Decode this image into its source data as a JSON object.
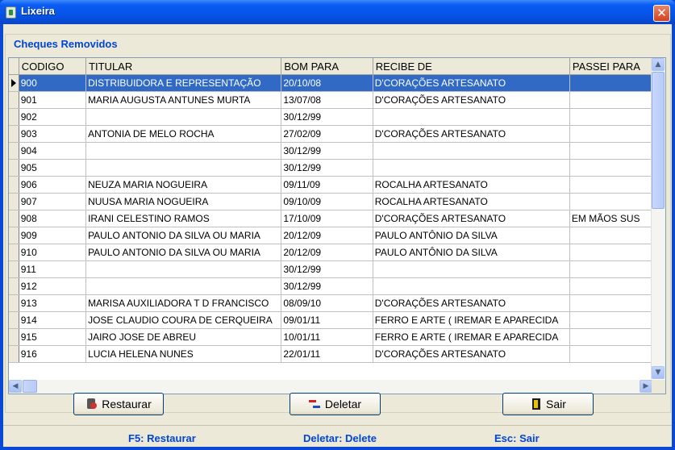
{
  "window": {
    "title": "Lixeira"
  },
  "group": {
    "title": "Cheques Removidos"
  },
  "grid": {
    "columns": [
      "CODIGO",
      "TITULAR",
      "BOM PARA",
      "RECIBE DE",
      "PASSEI PARA"
    ],
    "rows": [
      [
        "900",
        "DISTRIBUIDORA E REPRESENTAÇÃO",
        "20/10/08",
        "D'CORAÇÕES ARTESANATO",
        ""
      ],
      [
        "901",
        "MARIA AUGUSTA ANTUNES MURTA",
        "13/07/08",
        "D'CORAÇÕES ARTESANATO",
        ""
      ],
      [
        "902",
        "",
        "30/12/99",
        "",
        ""
      ],
      [
        "903",
        "ANTONIA DE MELO ROCHA",
        "27/02/09",
        "D'CORAÇÕES ARTESANATO",
        ""
      ],
      [
        "904",
        "",
        "30/12/99",
        "",
        ""
      ],
      [
        "905",
        "",
        "30/12/99",
        "",
        ""
      ],
      [
        "906",
        "NEUZA MARIA NOGUEIRA",
        "09/11/09",
        "ROCALHA ARTESANATO",
        ""
      ],
      [
        "907",
        "NUUSA MARIA NOGUEIRA",
        "09/10/09",
        "ROCALHA ARTESANATO",
        ""
      ],
      [
        "908",
        "IRANI CELESTINO RAMOS",
        "17/10/09",
        "D'CORAÇÕES ARTESANATO",
        "EM MÃOS SUS"
      ],
      [
        "909",
        "PAULO ANTONIO DA SILVA OU MARIA",
        "20/12/09",
        "PAULO ANTÔNIO DA SILVA",
        ""
      ],
      [
        "910",
        "PAULO ANTONIO DA SILVA OU MARIA",
        "20/12/09",
        "PAULO ANTÔNIO DA SILVA",
        ""
      ],
      [
        "911",
        "",
        "30/12/99",
        "",
        ""
      ],
      [
        "912",
        "",
        "30/12/99",
        "",
        ""
      ],
      [
        "913",
        "MARISA AUXILIADORA T D FRANCISCO",
        "08/09/10",
        "D'CORAÇÕES ARTESANATO",
        ""
      ],
      [
        "914",
        "JOSE CLAUDIO COURA DE CERQUEIRA",
        "09/01/11",
        "FERRO E ARTE ( IREMAR E APARECIDA",
        ""
      ],
      [
        "915",
        "JAIRO JOSE DE ABREU",
        "10/01/11",
        "FERRO E ARTE ( IREMAR E APARECIDA",
        ""
      ],
      [
        "916",
        "LUCIA HELENA NUNES",
        "22/01/11",
        "D'CORAÇÕES ARTESANATO",
        ""
      ]
    ],
    "selected_row": 0
  },
  "buttons": {
    "restore": "Restaurar",
    "delete": "Deletar",
    "exit": "Sair"
  },
  "status": {
    "f5": "F5: Restaurar",
    "delete": "Deletar: Delete",
    "esc": "Esc: Sair"
  },
  "icons": [
    "recycle-bin-icon",
    "close-icon",
    "restore-icon",
    "delete-icon",
    "exit-icon"
  ],
  "colors": {
    "titlebar": "#0551e3",
    "selection": "#316ac5",
    "status_text": "#0046d5"
  }
}
